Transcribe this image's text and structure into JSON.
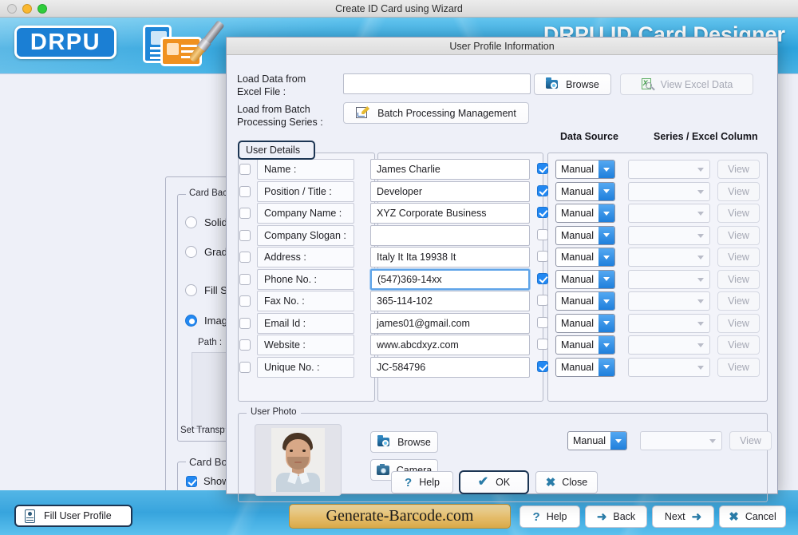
{
  "window": {
    "title": "Create ID Card using Wizard"
  },
  "app_header": {
    "logo_text": "DRPU",
    "product_title": "DRPU ID Card Designer"
  },
  "background_panel": {
    "card_background": {
      "group_title": "Card Back",
      "options": [
        {
          "label": "Solid",
          "selected": false
        },
        {
          "label": "Gradi",
          "selected": false
        },
        {
          "label": "Fill St",
          "selected": false
        },
        {
          "label": "Image",
          "selected": true
        }
      ],
      "path_label": "Path :",
      "set_transparency_label": "Set Transp"
    },
    "card_border": {
      "group_title": "Card Bor",
      "show_label": "Show",
      "show_checked": true
    }
  },
  "dialog": {
    "title": "User Profile Information",
    "excel_label": "Load Data from\nExcel File :",
    "excel_label_line1": "Load Data from",
    "excel_label_line2": "Excel File :",
    "excel_path_value": "",
    "browse_label": "Browse",
    "view_excel_label": "View Excel Data",
    "batch_label_line1": "Load from Batch",
    "batch_label_line2": "Processing Series :",
    "batch_button_label": "Batch Processing Management",
    "column_headers": {
      "data_source": "Data Source",
      "series_excel_column": "Series / Excel Column"
    },
    "tab_label": "User Details",
    "view_button_label": "View",
    "fields": [
      {
        "label": "Name :",
        "value": "James Charlie",
        "enabled": true,
        "source": "Manual",
        "series": "",
        "focused": false
      },
      {
        "label": "Position / Title :",
        "value": "Developer",
        "enabled": true,
        "source": "Manual",
        "series": "",
        "focused": false
      },
      {
        "label": "Company Name :",
        "value": "XYZ Corporate Business",
        "enabled": true,
        "source": "Manual",
        "series": "",
        "focused": false
      },
      {
        "label": "Company Slogan :",
        "value": "",
        "enabled": false,
        "source": "Manual",
        "series": "",
        "focused": false
      },
      {
        "label": "Address :",
        "value": "Italy   It Ita 19938 It",
        "enabled": false,
        "source": "Manual",
        "series": "",
        "focused": false
      },
      {
        "label": "Phone No. :",
        "value": "(547)369-14xx",
        "enabled": true,
        "source": "Manual",
        "series": "",
        "focused": true
      },
      {
        "label": "Fax No. :",
        "value": "365-114-102",
        "enabled": false,
        "source": "Manual",
        "series": "",
        "focused": false
      },
      {
        "label": "Email Id :",
        "value": "james01@gmail.com",
        "enabled": false,
        "source": "Manual",
        "series": "",
        "focused": false
      },
      {
        "label": "Website :",
        "value": "www.abcdxyz.com",
        "enabled": false,
        "source": "Manual",
        "series": "",
        "focused": false
      },
      {
        "label": "Unique No. :",
        "value": "JC-584796",
        "enabled": true,
        "source": "Manual",
        "series": "",
        "focused": false
      }
    ],
    "user_photo": {
      "group_title": "User Photo",
      "browse_label": "Browse",
      "camera_label": "Camera",
      "source": "Manual",
      "series": "",
      "view_label": "View"
    },
    "footer": {
      "help_label": "Help",
      "ok_label": "OK",
      "close_label": "Close"
    }
  },
  "bottom_bar": {
    "fill_user_profile_label": "Fill User Profile",
    "brand_label": "Generate-Barcode.com",
    "help_label": "Help",
    "back_label": "Back",
    "next_label": "Next",
    "cancel_label": "Cancel"
  },
  "colors": {
    "accent_blue": "#2288f2",
    "header_blue": "#2ea4de",
    "brand_gold": "#e5bd6b",
    "dialog_bg": "#eef0f8",
    "focus_border": "#5fa4e8"
  }
}
